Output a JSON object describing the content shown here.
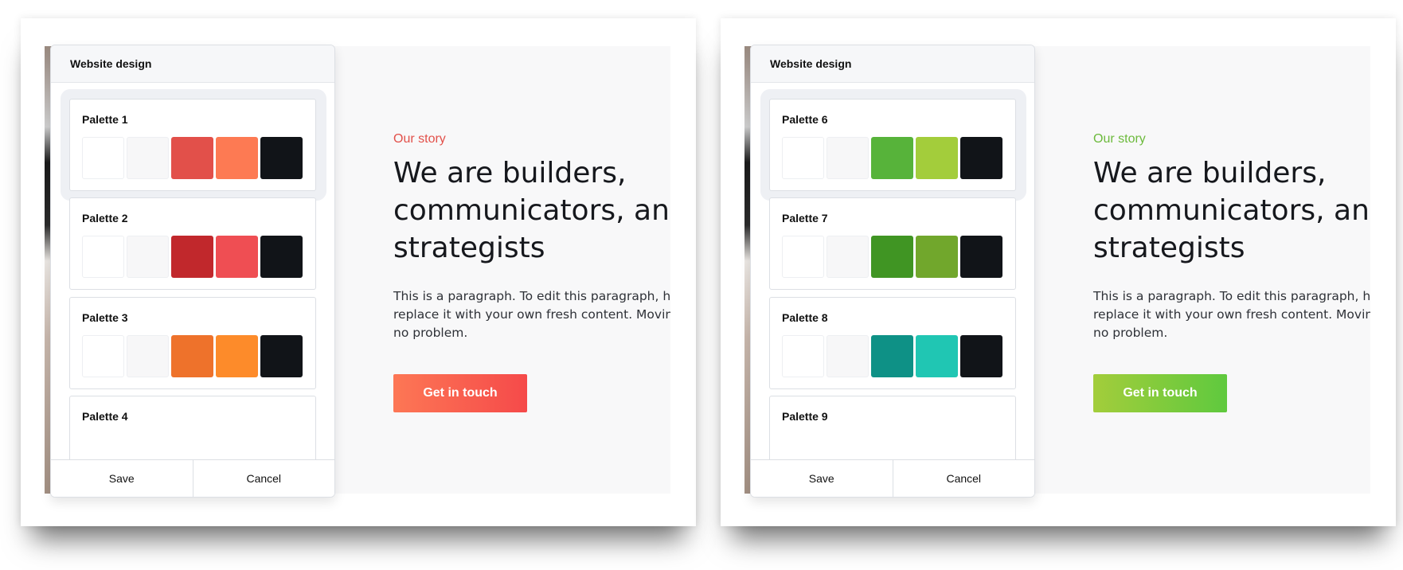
{
  "screens": [
    {
      "panel_title": "Website design",
      "palettes": [
        {
          "name": "Palette 1",
          "selected": true,
          "colors": [
            "#ffffff",
            "#f7f7f8",
            "#e2504a",
            "#fd7a53",
            "#111418"
          ]
        },
        {
          "name": "Palette 2",
          "selected": false,
          "colors": [
            "#ffffff",
            "#f7f7f8",
            "#c1282c",
            "#ef4e53",
            "#111418"
          ]
        },
        {
          "name": "Palette 3",
          "selected": false,
          "colors": [
            "#ffffff",
            "#f7f7f8",
            "#ee722b",
            "#fd8b2a",
            "#111418"
          ]
        },
        {
          "name": "Palette 4",
          "selected": false,
          "colors": []
        }
      ],
      "save_label": "Save",
      "cancel_label": "Cancel",
      "hero": {
        "kicker": "Our story",
        "headline_1": "We are builders,",
        "headline_2": "communicators, and",
        "headline_3": "strategists",
        "para_1": "This is a paragraph. To edit this paragraph, highlight",
        "para_2": "replace it with your own fresh content. Moving this",
        "para_3": "no problem.",
        "cta_label": "Get in touch",
        "accent": "#e2504a",
        "cta_gradient": [
          "#fd7755",
          "#f54a4a"
        ]
      }
    },
    {
      "panel_title": "Website design",
      "palettes": [
        {
          "name": "Palette 6",
          "selected": true,
          "colors": [
            "#ffffff",
            "#f7f7f8",
            "#57b33a",
            "#a3cd3b",
            "#111418"
          ]
        },
        {
          "name": "Palette 7",
          "selected": false,
          "colors": [
            "#ffffff",
            "#f7f7f8",
            "#409523",
            "#71a72c",
            "#111418"
          ]
        },
        {
          "name": "Palette 8",
          "selected": false,
          "colors": [
            "#ffffff",
            "#f7f7f8",
            "#0e9186",
            "#20c6b3",
            "#111418"
          ]
        },
        {
          "name": "Palette 9",
          "selected": false,
          "colors": []
        }
      ],
      "save_label": "Save",
      "cancel_label": "Cancel",
      "hero": {
        "kicker": "Our story",
        "headline_1": "We are builders,",
        "headline_2": "communicators, and",
        "headline_3": "strategists",
        "para_1": "This is a paragraph. To edit this paragraph, highlight",
        "para_2": "replace it with your own fresh content. Moving this",
        "para_3": "no problem.",
        "cta_label": "Get in touch",
        "accent": "#6cba3c",
        "cta_gradient": [
          "#a3cd3b",
          "#5fc93e"
        ]
      }
    }
  ]
}
